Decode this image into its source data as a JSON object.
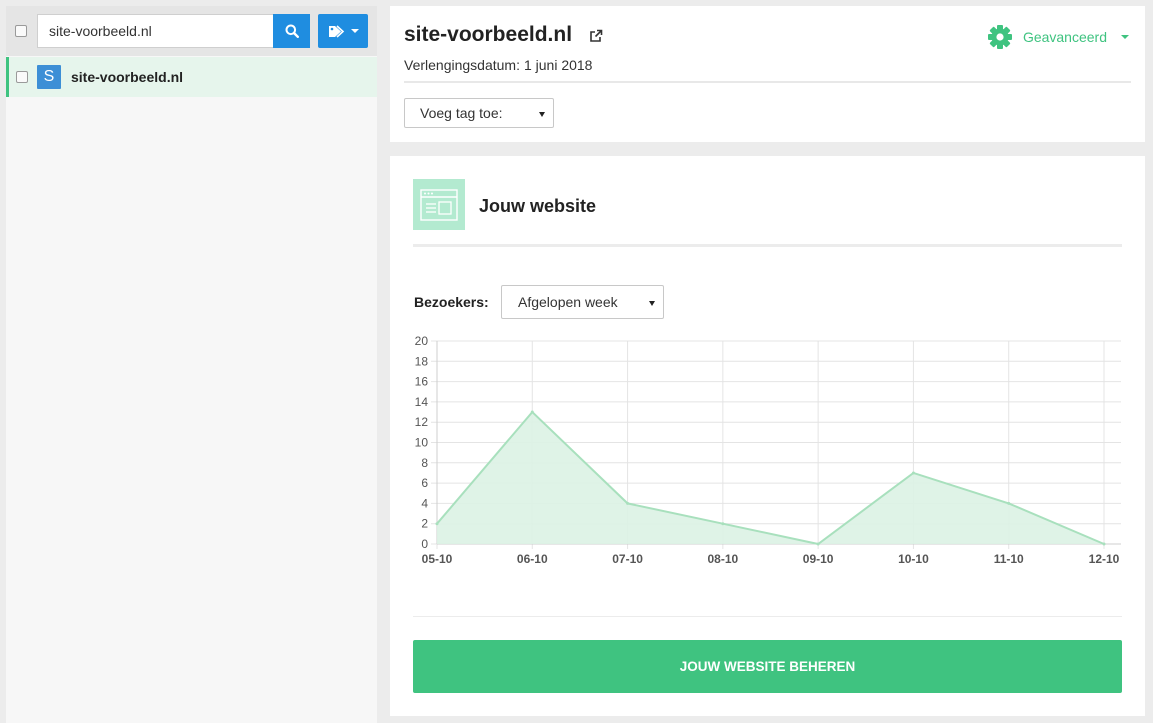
{
  "sidebar": {
    "search": {
      "value": "site-voorbeeld.nl"
    },
    "items": [
      {
        "avatar": "S",
        "label": "site-voorbeeld.nl"
      }
    ]
  },
  "header": {
    "domain": "site-voorbeeld.nl",
    "renewal_label": "Verlengingsdatum:",
    "renewal_date": "1 juni 2018",
    "advanced_label": "Geavanceerd",
    "tag_select": "Voeg tag toe:"
  },
  "website": {
    "title": "Jouw website",
    "visitors_label": "Bezoekers:",
    "period_select": "Afgelopen week",
    "manage_button": "JOUW WEBSITE BEHEREN"
  },
  "colors": {
    "accent": "#3fc380",
    "primary": "#1f8de0",
    "chart_line": "#a8e0bd",
    "chart_fill": "#dcf2e4"
  },
  "icons": {
    "search": "search-icon",
    "tag": "tag-icon",
    "external": "external-link-icon",
    "gear": "gear-icon",
    "website": "browser-window-icon"
  },
  "chart_data": {
    "type": "area",
    "title": "",
    "xlabel": "",
    "ylabel": "",
    "categories": [
      "05-10",
      "06-10",
      "07-10",
      "08-10",
      "09-10",
      "10-10",
      "11-10",
      "12-10"
    ],
    "series": [
      {
        "values": [
          2,
          13,
          4,
          2,
          0,
          7,
          4,
          0
        ]
      }
    ],
    "yticks": [
      0,
      2,
      4,
      6,
      8,
      10,
      12,
      14,
      16,
      18,
      20
    ],
    "ylim": [
      0,
      20
    ],
    "grid": true,
    "legend": "none"
  }
}
